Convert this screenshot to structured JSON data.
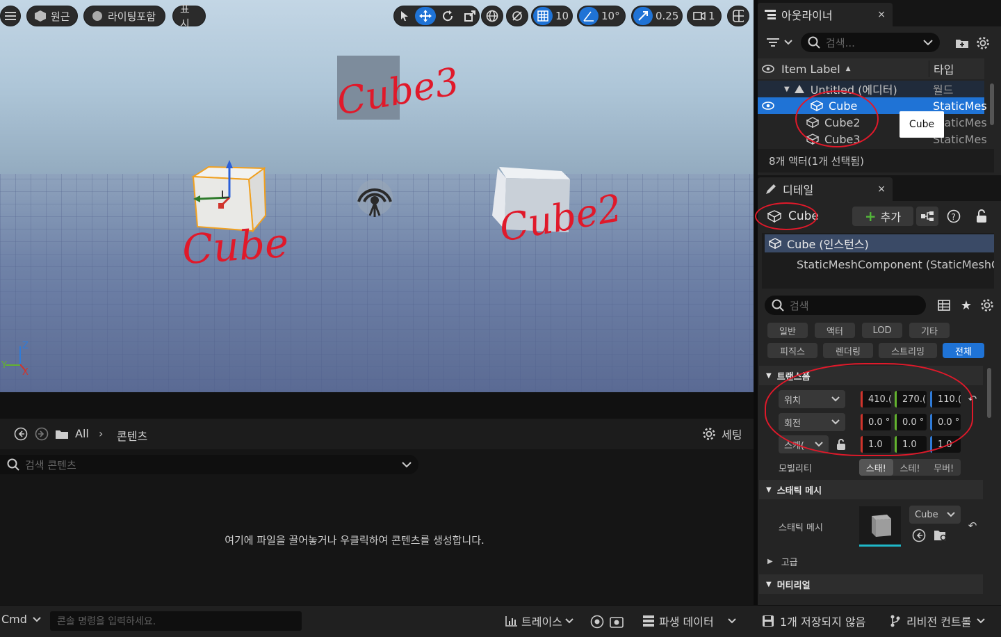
{
  "viewport": {
    "menu_label": "",
    "perspective_label": "원근",
    "lighting_label": "라이팅포함",
    "show_label": "표시",
    "grid_snap": "10",
    "rotation_snap": "10°",
    "scale_snap": "0.25",
    "camera_speed": "1",
    "axis_z": "Z",
    "axis_y": "Y",
    "axis_x": "X",
    "annotations": [
      "Cube",
      "Cube2",
      "Cube3"
    ]
  },
  "outliner": {
    "tab_title": "아웃라이너",
    "close": "×",
    "search_placeholder": "검색...",
    "col_label": "Item Label",
    "col_type": "타입",
    "rows": [
      {
        "label": "Untitled (에디터)",
        "type": "월드"
      },
      {
        "label": "Cube",
        "type": "StaticMes"
      },
      {
        "label": "Cube2",
        "type": "StaticMes"
      },
      {
        "label": "Cube3",
        "type": "StaticMes"
      }
    ],
    "tooltip": "Cube",
    "footer": "8개 액터(1개 선택됨)"
  },
  "details": {
    "tab_title": "디테일",
    "close": "×",
    "actor_name": "Cube",
    "add_label": "추가",
    "components": [
      "Cube (인스턴스)",
      "StaticMeshComponent (StaticMeshC"
    ],
    "search_placeholder": "검색",
    "filters_row1": [
      "일반",
      "액터",
      "LOD",
      "기타"
    ],
    "filters_row2": [
      "피직스",
      "렌더링",
      "스트리밍",
      "전체"
    ],
    "transform_header": "트랜스폼",
    "location_label": "위치",
    "rotation_label": "회전",
    "scale_label": "스케(",
    "location": [
      "410.(",
      "270.(",
      "110.("
    ],
    "rotation": [
      "0.0 °",
      "0.0 °",
      "0.0 °"
    ],
    "scale": [
      "1.0",
      "1.0",
      "1.0"
    ],
    "mobility_label": "모빌리티",
    "mobility_options": [
      "스태!",
      "스테!",
      "무버!"
    ],
    "static_mesh_header": "스태틱 메시",
    "static_mesh_label": "스태틱 메시",
    "mesh_value": "Cube",
    "advanced_label": "고급",
    "material_header": "머티리얼"
  },
  "content_browser": {
    "path_root": "All",
    "path_child": "콘텐츠",
    "settings_label": "세팅",
    "search_placeholder": "검색 콘텐츠",
    "empty_message": "여기에 파일을 끌어놓거나 우클릭하여 콘텐츠를 생성합니다."
  },
  "statusbar": {
    "cmd_label": "Cmd",
    "console_placeholder": "콘솔 명령을 입력하세요.",
    "trace_label": "트레이스",
    "derived_data_label": "파생 데이터",
    "unsaved_label": "1개 저장되지 않음",
    "revision_label": "리비전 컨트롤"
  },
  "colors": {
    "accent": "#1f73d6",
    "annotation_red": "#e0192a",
    "panel_bg": "#242424"
  }
}
